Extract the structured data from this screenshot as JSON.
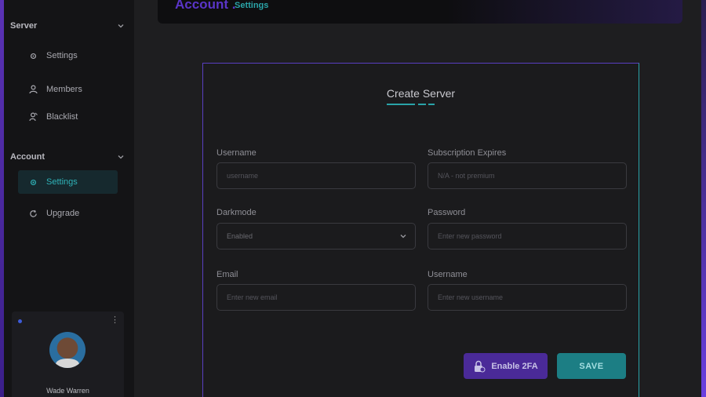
{
  "header": {
    "crumb_main": "Account .",
    "crumb_sub": "Settings"
  },
  "sidebar": {
    "sections": [
      {
        "title": "Server",
        "items": [
          {
            "label": "Settings",
            "icon": "gear-icon"
          },
          {
            "label": "Members",
            "icon": "user-icon"
          },
          {
            "label": "Blacklist",
            "icon": "user-block-icon"
          }
        ]
      },
      {
        "title": "Account",
        "items": [
          {
            "label": "Settings",
            "icon": "gear-icon",
            "active": true
          },
          {
            "label": "Upgrade",
            "icon": "refresh-icon"
          }
        ]
      }
    ],
    "profile": {
      "name": "Wade Warren"
    }
  },
  "form": {
    "title": "Create Server",
    "fields": {
      "username": {
        "label": "Username",
        "placeholder": "username"
      },
      "subscription": {
        "label": "Subscription Expires",
        "placeholder": "N/A - not premium"
      },
      "darkmode": {
        "label": "Darkmode",
        "value": "Enabled"
      },
      "password": {
        "label": "Password",
        "placeholder": "Enter new password"
      },
      "email": {
        "label": "Email",
        "placeholder": "Enter new email"
      },
      "username2": {
        "label": "Username",
        "placeholder": "Enter new username"
      }
    },
    "buttons": {
      "enable_2fa": "Enable 2FA",
      "save": "SAVE"
    }
  },
  "colors": {
    "accent_teal": "#2aa3a8",
    "accent_purple": "#5a35c8",
    "background": "#1e1e20",
    "sidebar": "#141416"
  }
}
